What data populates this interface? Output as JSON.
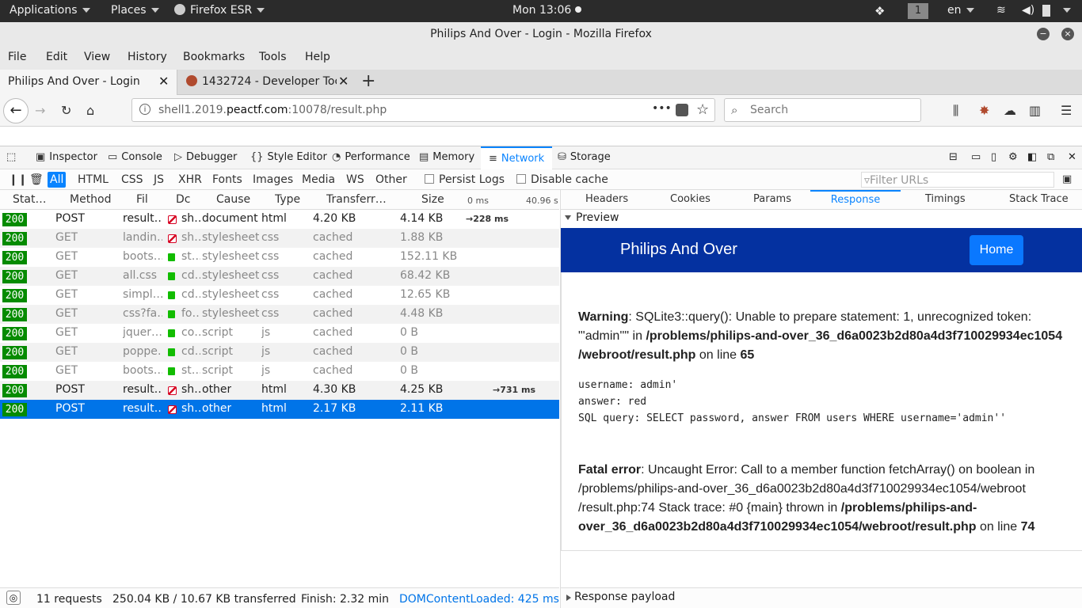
{
  "topbar": {
    "applications": "Applications",
    "places": "Places",
    "firefox": "Firefox ESR",
    "clock": "Mon 13:06",
    "workspace": "1",
    "lang": "en"
  },
  "window": {
    "title": "Philips And Over - Login - Mozilla Firefox"
  },
  "menu": [
    "File",
    "Edit",
    "View",
    "History",
    "Bookmarks",
    "Tools",
    "Help"
  ],
  "tabs": [
    {
      "label": "Philips And Over - Login"
    },
    {
      "label": "1432724 - Developer Toc"
    }
  ],
  "urlbar": {
    "prefix": "shell1.2019.",
    "domain": "peactf.com",
    "suffix": ":10078/result.php",
    "search_placeholder": "Search",
    "more": "•••"
  },
  "devtools": {
    "tabs": [
      "Inspector",
      "Console",
      "Debugger",
      "Style Editor",
      "Performance",
      "Memory",
      "Network",
      "Storage"
    ],
    "filters": [
      "All",
      "HTML",
      "CSS",
      "JS",
      "XHR",
      "Fonts",
      "Images",
      "Media",
      "WS",
      "Other"
    ],
    "persist": "Persist Logs",
    "disable_cache": "Disable cache",
    "filter_placeholder": "Filter URLs",
    "columns": [
      "Stat…",
      "Method",
      "Fil",
      "Dc",
      "Cause",
      "Type",
      "Transferr…",
      "Size",
      "0 ms",
      "40.96 s"
    ],
    "rows": [
      {
        "status": "200",
        "method": "POST",
        "file": "result…",
        "domain": "sh…",
        "cause": "document",
        "type": "html",
        "transferred": "4.20 KB",
        "size": "4.14 KB",
        "timing": "228 ms",
        "secure": false
      },
      {
        "status": "200",
        "method": "GET",
        "file": "landin…",
        "domain": "sh…",
        "cause": "stylesheet",
        "type": "css",
        "transferred": "cached",
        "size": "1.88 KB",
        "secure": false
      },
      {
        "status": "200",
        "method": "GET",
        "file": "boots…",
        "domain": "st…",
        "cause": "stylesheet",
        "type": "css",
        "transferred": "cached",
        "size": "152.11 KB",
        "secure": true
      },
      {
        "status": "200",
        "method": "GET",
        "file": "all.css",
        "domain": "cd…",
        "cause": "stylesheet",
        "type": "css",
        "transferred": "cached",
        "size": "68.42 KB",
        "secure": true
      },
      {
        "status": "200",
        "method": "GET",
        "file": "simpl…",
        "domain": "cd…",
        "cause": "stylesheet",
        "type": "css",
        "transferred": "cached",
        "size": "12.65 KB",
        "secure": true
      },
      {
        "status": "200",
        "method": "GET",
        "file": "css?fa…",
        "domain": "fo…",
        "cause": "stylesheet",
        "type": "css",
        "transferred": "cached",
        "size": "4.48 KB",
        "secure": true
      },
      {
        "status": "200",
        "method": "GET",
        "file": "jquer…",
        "domain": "co…",
        "cause": "script",
        "type": "js",
        "transferred": "cached",
        "size": "0 B",
        "secure": true
      },
      {
        "status": "200",
        "method": "GET",
        "file": "poppe…",
        "domain": "cd…",
        "cause": "script",
        "type": "js",
        "transferred": "cached",
        "size": "0 B",
        "secure": true
      },
      {
        "status": "200",
        "method": "GET",
        "file": "boots…",
        "domain": "st…",
        "cause": "script",
        "type": "js",
        "transferred": "cached",
        "size": "0 B",
        "secure": true
      },
      {
        "status": "200",
        "method": "POST",
        "file": "result…",
        "domain": "sh…",
        "cause": "other",
        "type": "html",
        "transferred": "4.30 KB",
        "size": "4.25 KB",
        "timing": "731 ms",
        "secure": false
      },
      {
        "status": "200",
        "method": "POST",
        "file": "result…",
        "domain": "sh…",
        "cause": "other",
        "type": "html",
        "transferred": "2.17 KB",
        "size": "2.11 KB",
        "secure": false,
        "selected": true
      }
    ],
    "detail_tabs": [
      "Headers",
      "Cookies",
      "Params",
      "Response",
      "Timings",
      "Stack Trace"
    ],
    "preview_label": "Preview",
    "payload_label": "Response payload",
    "status": {
      "requests": "11 requests",
      "transferred": "250.04 KB / 10.67 KB transferred",
      "finish": "Finish: 2.32 min",
      "dcl": "DOMContentLoaded: 425 ms"
    }
  },
  "page": {
    "brand": "Philips And Over",
    "home": "Home",
    "warning_label": "Warning",
    "warning_text": ": SQLite3::query(): Unable to prepare statement: 1, unrecognized token: \"'admin''\" in ",
    "warning_path": "/problems/philips-and-over_36_d6a0023b2d80a4d3f710029934ec1054 /webroot/result.php",
    "warning_on": " on line ",
    "warning_line": "65",
    "mono_lines": [
      "username: admin'",
      "answer: red",
      "SQL query: SELECT password, answer FROM users WHERE username='admin''"
    ],
    "fatal_label": "Fatal error",
    "fatal_text": ": Uncaught Error: Call to a member function fetchArray() on boolean in /problems/philips-and-over_36_d6a0023b2d80a4d3f710029934ec1054/webroot /result.php:74 Stack trace: #0 {main} thrown in ",
    "fatal_path": "/problems/philips-and-over_36_d6a0023b2d80a4d3f710029934ec1054/webroot/result.php",
    "fatal_on": " on line ",
    "fatal_line": "74"
  }
}
